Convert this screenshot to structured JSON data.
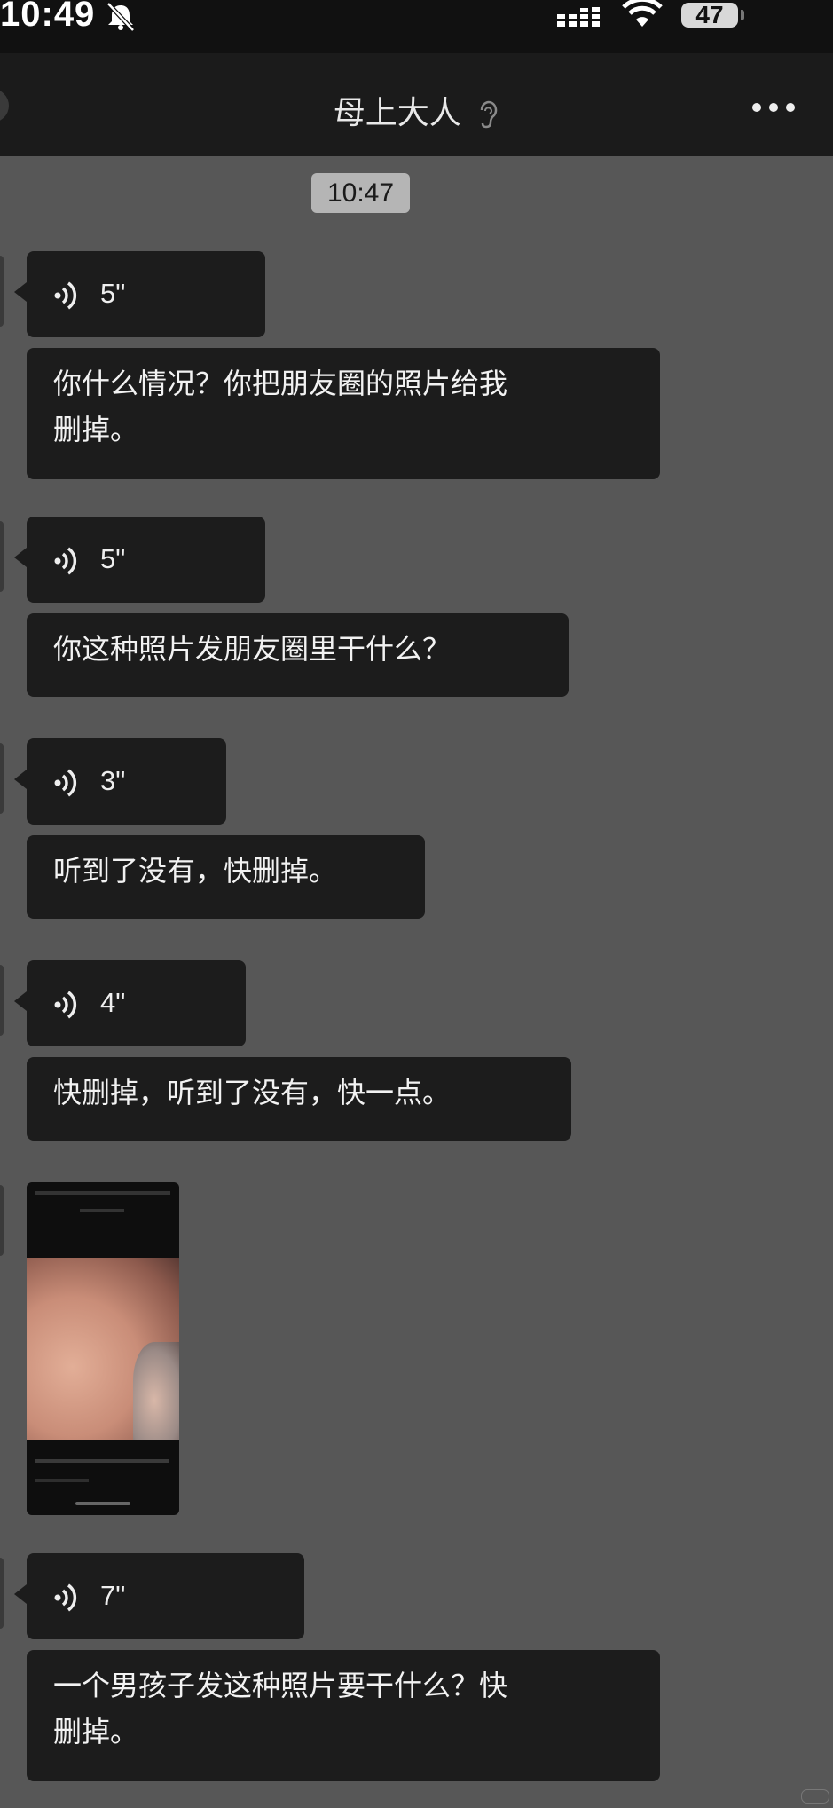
{
  "status_bar": {
    "time": "10:49",
    "battery": "47",
    "icons": [
      "bell-muted-icon",
      "signal-icon",
      "wifi-icon",
      "battery-icon"
    ]
  },
  "nav": {
    "title": "母上大人",
    "title_icon": "ear-icon",
    "more_icon": "more-dots-icon"
  },
  "chat": {
    "timestamp": "10:47",
    "voice_messages": [
      {
        "duration": "5\""
      },
      {
        "duration": "5\""
      },
      {
        "duration": "3\""
      },
      {
        "duration": "4\""
      },
      {
        "duration": "7\""
      }
    ],
    "text_messages": [
      {
        "line1": "你什么情况？你把朋友圈的照片给我",
        "line2": "删掉。"
      },
      {
        "line1": "你这种照片发朋友圈里干什么？"
      },
      {
        "line1": "听到了没有，快删掉。"
      },
      {
        "line1": "快删掉，听到了没有，快一点。"
      },
      {
        "line1": "一个男孩子发这种照片要干什么？快",
        "line2": "删掉。"
      }
    ]
  },
  "colors": {
    "chat_background": "#575757",
    "bubble": "#1c1c1c",
    "nav_background": "#1b1b1b"
  }
}
